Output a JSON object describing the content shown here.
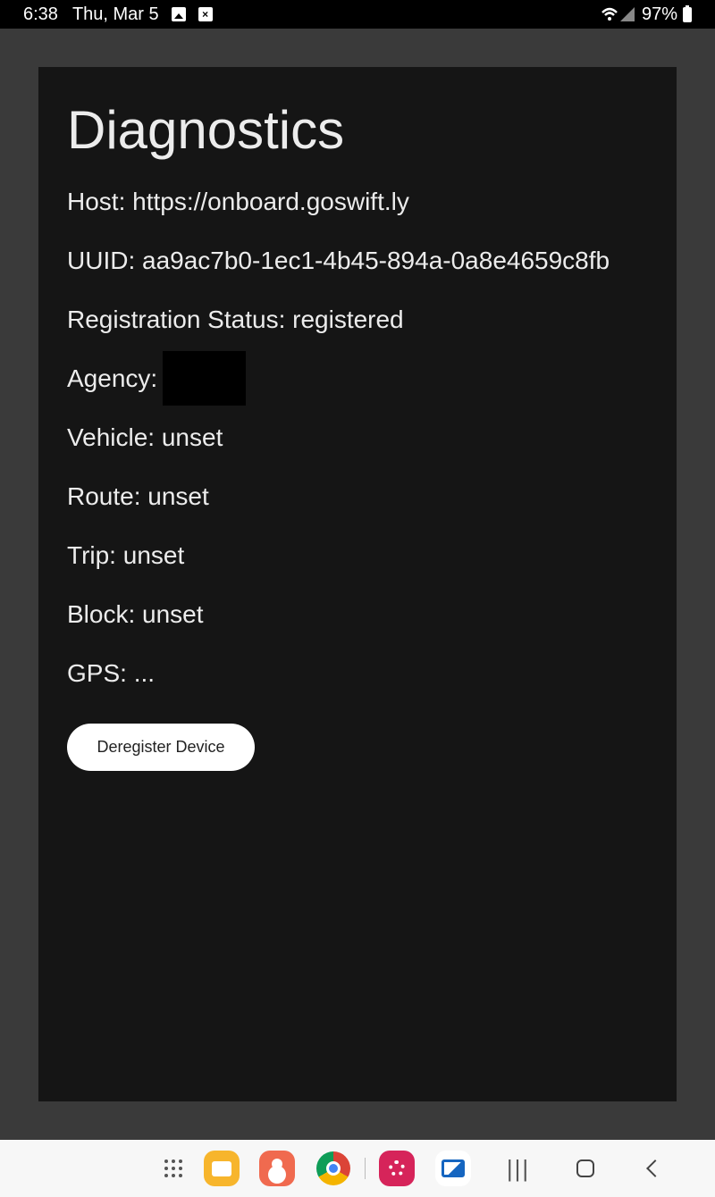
{
  "status_bar": {
    "time": "6:38",
    "date": "Thu, Mar 5",
    "battery": "97%"
  },
  "diagnostics": {
    "title": "Diagnostics",
    "host": "Host: https://onboard.goswift.ly",
    "uuid": "UUID: aa9ac7b0-1ec1-4b45-894a-0a8e4659c8fb",
    "registration_status": "Registration Status: registered",
    "agency_label": "Agency:",
    "vehicle": "Vehicle: unset",
    "route": "Route: unset",
    "trip": "Trip: unset",
    "block": "Block: unset",
    "gps": "GPS: ...",
    "deregister_label": "Deregister Device"
  },
  "nav_bar": {
    "icons": [
      "apps-grid-icon",
      "my-files-icon",
      "contacts-icon",
      "chrome-icon",
      "flower-app-icon",
      "cast-icon",
      "recents-icon",
      "home-icon",
      "back-icon"
    ]
  }
}
